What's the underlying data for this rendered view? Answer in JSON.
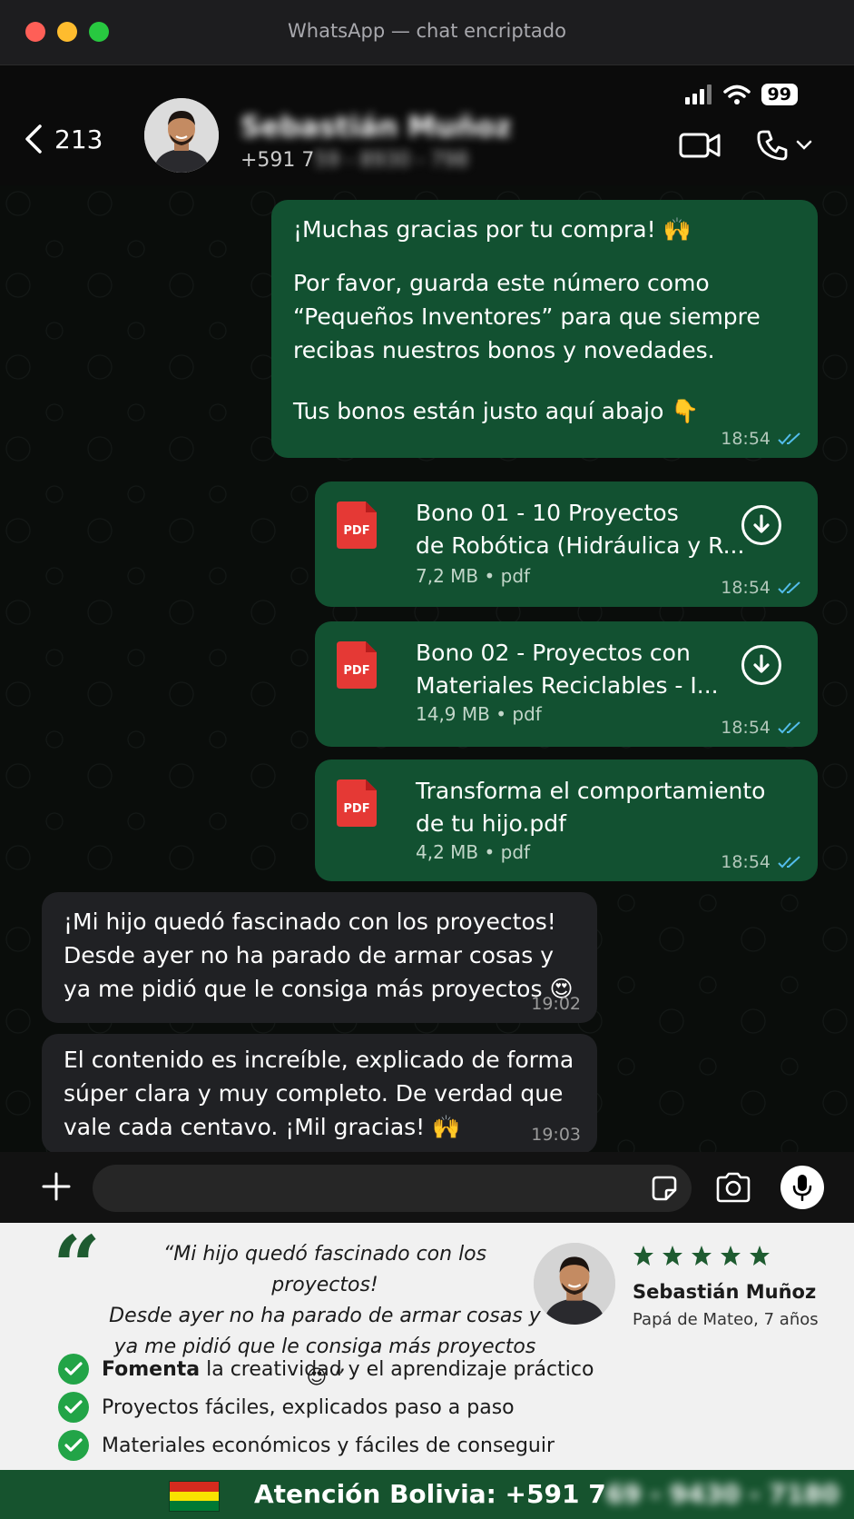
{
  "window": {
    "title": "WhatsApp — chat encriptado"
  },
  "status_bar": {
    "battery": "99"
  },
  "header": {
    "back_count": "213",
    "contact_name": "Sebastián Muñoz",
    "phone_prefix": "+591 7",
    "phone_blurred": "59 - 8930 - 798"
  },
  "messages": [
    {
      "type": "text",
      "direction": "out",
      "paragraphs": [
        "¡Muchas gracias por tu compra! 🙌",
        "Por favor, guarda este número como “Pequeños Inventores” para que siempre recibas nuestros bonos y novedades.",
        "Tus bonos están justo aquí abajo 👇"
      ],
      "time": "18:54"
    },
    {
      "type": "document",
      "direction": "out",
      "title_line1": "Bono 01 - 10 Proyectos",
      "title_line2": "de Robótica (Hidráulica y R...",
      "size": "7,2 MB • pdf",
      "time": "18:54"
    },
    {
      "type": "document",
      "direction": "out",
      "title_line1": "Bono 02 - Proyectos con",
      "title_line2": "Materiales Reciclables - I...",
      "size": "14,9 MB • pdf",
      "time": "18:54"
    },
    {
      "type": "document",
      "direction": "out",
      "title_line1": "Transforma el comportamiento",
      "title_line2": "de tu hijo.pdf",
      "size": "4,2 MB • pdf",
      "time": "18:54"
    },
    {
      "type": "text",
      "direction": "in",
      "lines": [
        "¡Mi hijo quedó fascinado con los proyectos!",
        "Desde ayer no ha parado de armar cosas y",
        "ya me pidió que le consiga más proyectos 😍"
      ],
      "time": "19:02"
    },
    {
      "type": "text",
      "direction": "in",
      "lines": [
        "El contenido es increíble, explicado de forma",
        "súper clara y muy completo. De verdad que",
        "vale cada centavo. ¡Mil gracias! 🙌"
      ],
      "time": "19:03"
    }
  ],
  "pdf_label": "PDF",
  "input": {
    "placeholder": ""
  },
  "testimonial": {
    "quote_lines": [
      "“Mi hijo quedó fascinado con los proyectos!",
      "Desde ayer no ha parado de armar cosas y",
      "ya me pidió que le consiga más proyectos 😍 ”"
    ],
    "rating": 5,
    "name": "Sebastián Muñoz",
    "subtitle": "Papá de Mateo, 7 años",
    "benefits": [
      {
        "bold": "Fomenta",
        "text": " la creatividad y el aprendizaje práctico"
      },
      {
        "bold": "",
        "text": "Proyectos fáciles, explicados paso a paso"
      },
      {
        "bold": "",
        "text": "Materiales económicos y fáciles de conseguir"
      }
    ]
  },
  "footer": {
    "label": "Atención Bolivia: +591 7",
    "blurred": "69 - 9430 - 7180"
  },
  "colors": {
    "outgoing_bubble": "#125131",
    "incoming_bubble": "#202124",
    "accent_green": "#22a447",
    "footer_bg": "#16532e",
    "read_tick": "#53bdeb"
  }
}
